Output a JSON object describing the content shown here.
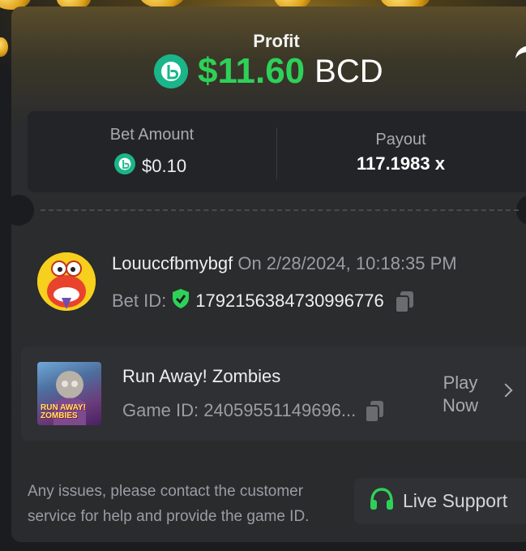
{
  "profit": {
    "label": "Profit",
    "amount": "$11.60",
    "unit": "BCD",
    "coin_icon": "bcd-coin-icon",
    "accent_color": "#2ed158"
  },
  "stats": {
    "bet_amount_label": "Bet Amount",
    "bet_amount_value": "$0.10",
    "payout_label": "Payout",
    "payout_value": "117.1983 x"
  },
  "bet": {
    "username": "Louuccfbmybgf",
    "date_text": "On 2/28/2024, 10:18:35 PM",
    "bet_id_label": "Bet ID:",
    "bet_id": "1792156384730996776"
  },
  "game": {
    "name": "Run Away! Zombies",
    "id_text": "Game ID: 24059551149696...",
    "thumb_text_1": "RUN AWAY!",
    "thumb_text_2": "ZOMBIES",
    "play_label": "Play Now"
  },
  "footer": {
    "note": "Any issues, please contact the customer service for help and provide the game ID.",
    "support_label": "Live Support"
  }
}
